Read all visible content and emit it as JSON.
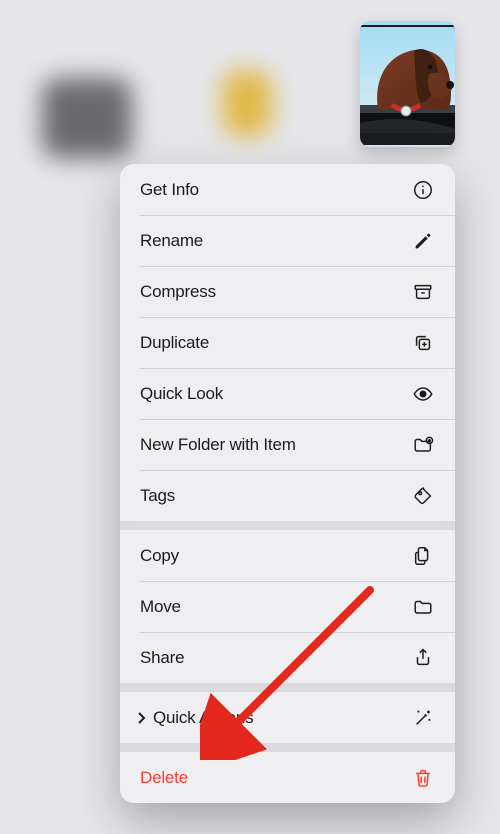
{
  "thumbnail": {
    "alt": "dog-in-car-window"
  },
  "menu": {
    "group1": [
      {
        "label": "Get Info",
        "icon": "info"
      },
      {
        "label": "Rename",
        "icon": "pencil"
      },
      {
        "label": "Compress",
        "icon": "archivebox"
      },
      {
        "label": "Duplicate",
        "icon": "plus-square-on-square"
      },
      {
        "label": "Quick Look",
        "icon": "eye"
      },
      {
        "label": "New Folder with Item",
        "icon": "folder-badge-plus"
      },
      {
        "label": "Tags",
        "icon": "tag"
      }
    ],
    "group2": [
      {
        "label": "Copy",
        "icon": "doc-on-doc"
      },
      {
        "label": "Move",
        "icon": "folder"
      },
      {
        "label": "Share",
        "icon": "share"
      }
    ],
    "group3": [
      {
        "label": "Quick Actions",
        "icon": "sparkles-wand",
        "hasChevron": true
      }
    ],
    "group4": [
      {
        "label": "Delete",
        "icon": "trash",
        "red": true
      }
    ]
  },
  "colors": {
    "destructive": "#ff3b30",
    "arrow": "#e3281d"
  }
}
